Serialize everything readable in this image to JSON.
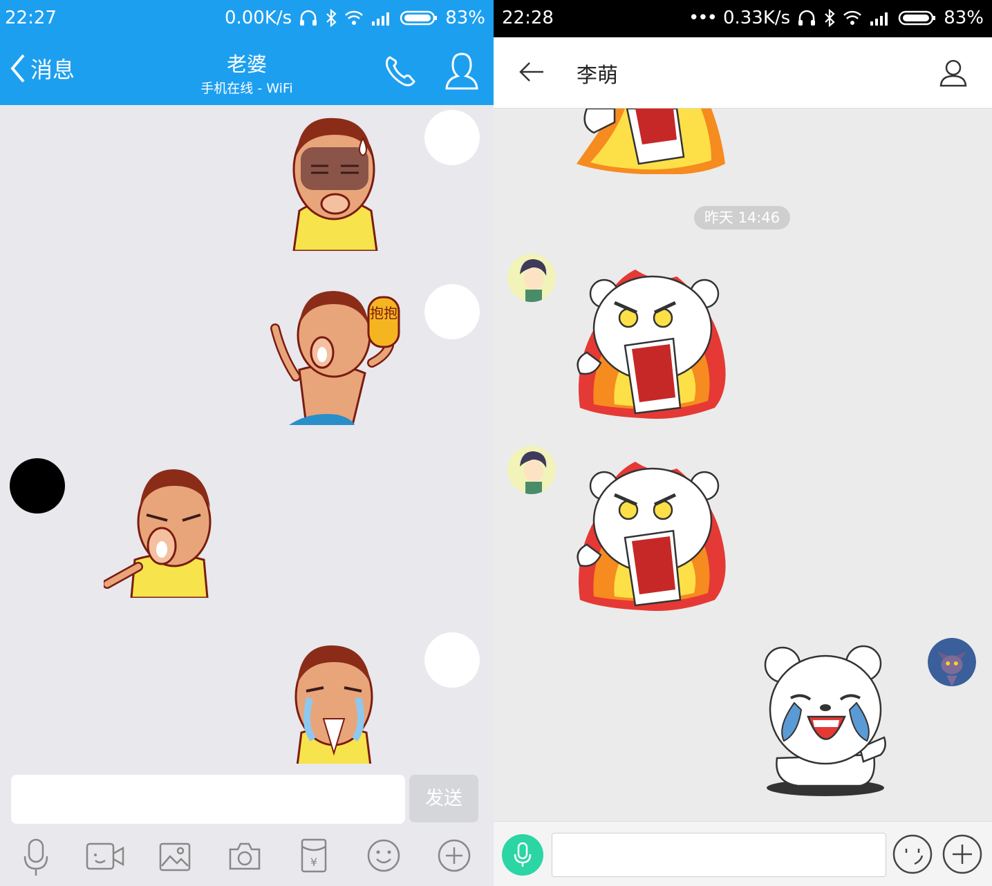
{
  "left": {
    "status": {
      "time": "22:27",
      "speed": "0.00K/s",
      "battery": "83%"
    },
    "header": {
      "back_label": "消息",
      "title": "老婆",
      "subtitle": "手机在线 - WiFi"
    },
    "messages": [
      {
        "side": "right",
        "sticker": "sweating-man-sticker"
      },
      {
        "side": "right",
        "sticker": "hug-man-sticker",
        "sticker_text": "抱抱"
      },
      {
        "side": "left",
        "sticker": "pointing-man-sticker"
      },
      {
        "side": "right",
        "sticker": "crying-man-sticker"
      }
    ],
    "input": {
      "value": "",
      "send_label": "发送"
    },
    "toolbar": [
      "mic-icon",
      "video-icon",
      "image-icon",
      "camera-icon",
      "red-packet-icon",
      "emoji-icon",
      "plus-icon"
    ]
  },
  "right": {
    "status": {
      "time": "22:28",
      "speed": "0.33K/s",
      "battery": "83%"
    },
    "header": {
      "title": "李萌"
    },
    "timestamp": "昨天 14:46",
    "messages": [
      {
        "side": "left",
        "sticker": "angry-bear-fire-sticker"
      },
      {
        "side": "left",
        "sticker": "angry-bear-fire-sticker"
      },
      {
        "side": "right",
        "sticker": "crying-bear-sticker"
      }
    ],
    "input": {
      "value": ""
    }
  }
}
